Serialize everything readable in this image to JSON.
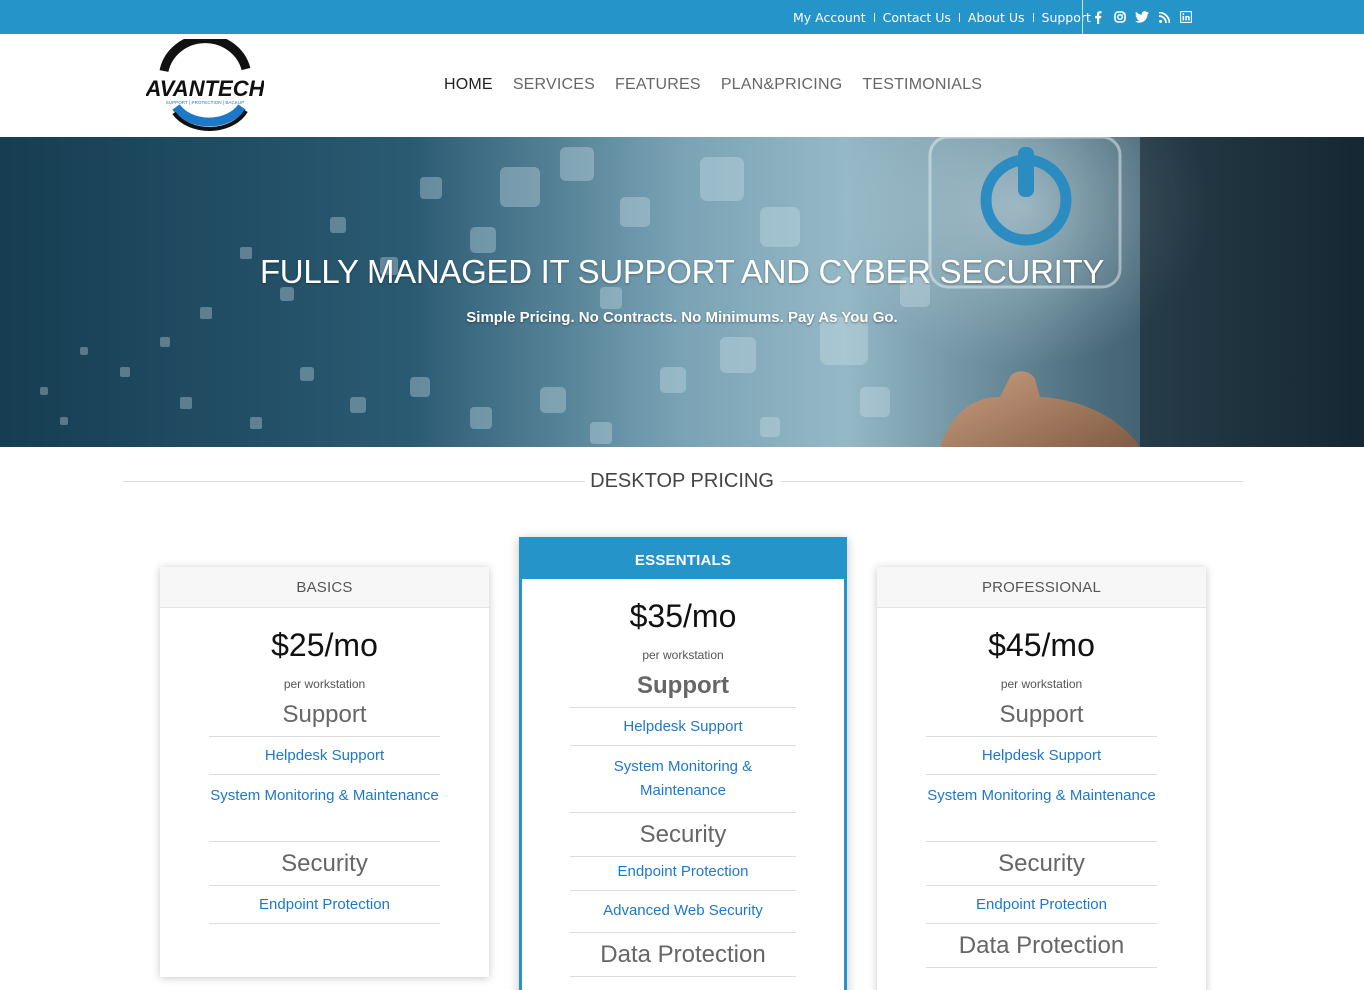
{
  "topbar": {
    "links": [
      "My Account",
      "Contact Us",
      "About Us",
      "Support"
    ],
    "social_icons": [
      "facebook-icon",
      "instagram-icon",
      "twitter-icon",
      "rss-icon",
      "linkedin-icon"
    ]
  },
  "logo": {
    "text": "AVANTECH",
    "tagline": "SUPPORT | PROTECTION | BACKUP"
  },
  "nav": [
    "HOME",
    "SERVICES",
    "FEATURES",
    "PLAN&PRICING",
    "TESTIMONIALS"
  ],
  "hero": {
    "title": "FULLY MANAGED IT SUPPORT AND CYBER SECURITY",
    "subtitle": "Simple Pricing. No Contracts. No Minimums. Pay As You Go."
  },
  "section_title": "DESKTOP PRICING",
  "plans": [
    {
      "name": "BASICS",
      "price": "$25/mo",
      "unit": "per workstation",
      "support_label": "Support",
      "support_items": [
        "Helpdesk Support",
        "System Monitoring & Maintenance"
      ],
      "security_label": "Security",
      "security_items": [
        "Endpoint Protection"
      ]
    },
    {
      "name": "ESSENTIALS",
      "price": "$35/mo",
      "unit": "per workstation",
      "support_label": "Support",
      "support_items": [
        "Helpdesk Support",
        "System Monitoring & Maintenance"
      ],
      "security_label": "Security",
      "security_items": [
        "Endpoint Protection",
        "Advanced Web Security"
      ],
      "data_label": "Data Protection"
    },
    {
      "name": "PROFESSIONAL",
      "price": "$45/mo",
      "unit": "per workstation",
      "support_label": "Support",
      "support_items": [
        "Helpdesk Support",
        "System Monitoring & Maintenance"
      ],
      "security_label": "Security",
      "security_items": [
        "Endpoint Protection"
      ],
      "data_label": "Data Protection"
    }
  ],
  "colors": {
    "accent": "#2494c9",
    "link": "#1e78c8"
  }
}
